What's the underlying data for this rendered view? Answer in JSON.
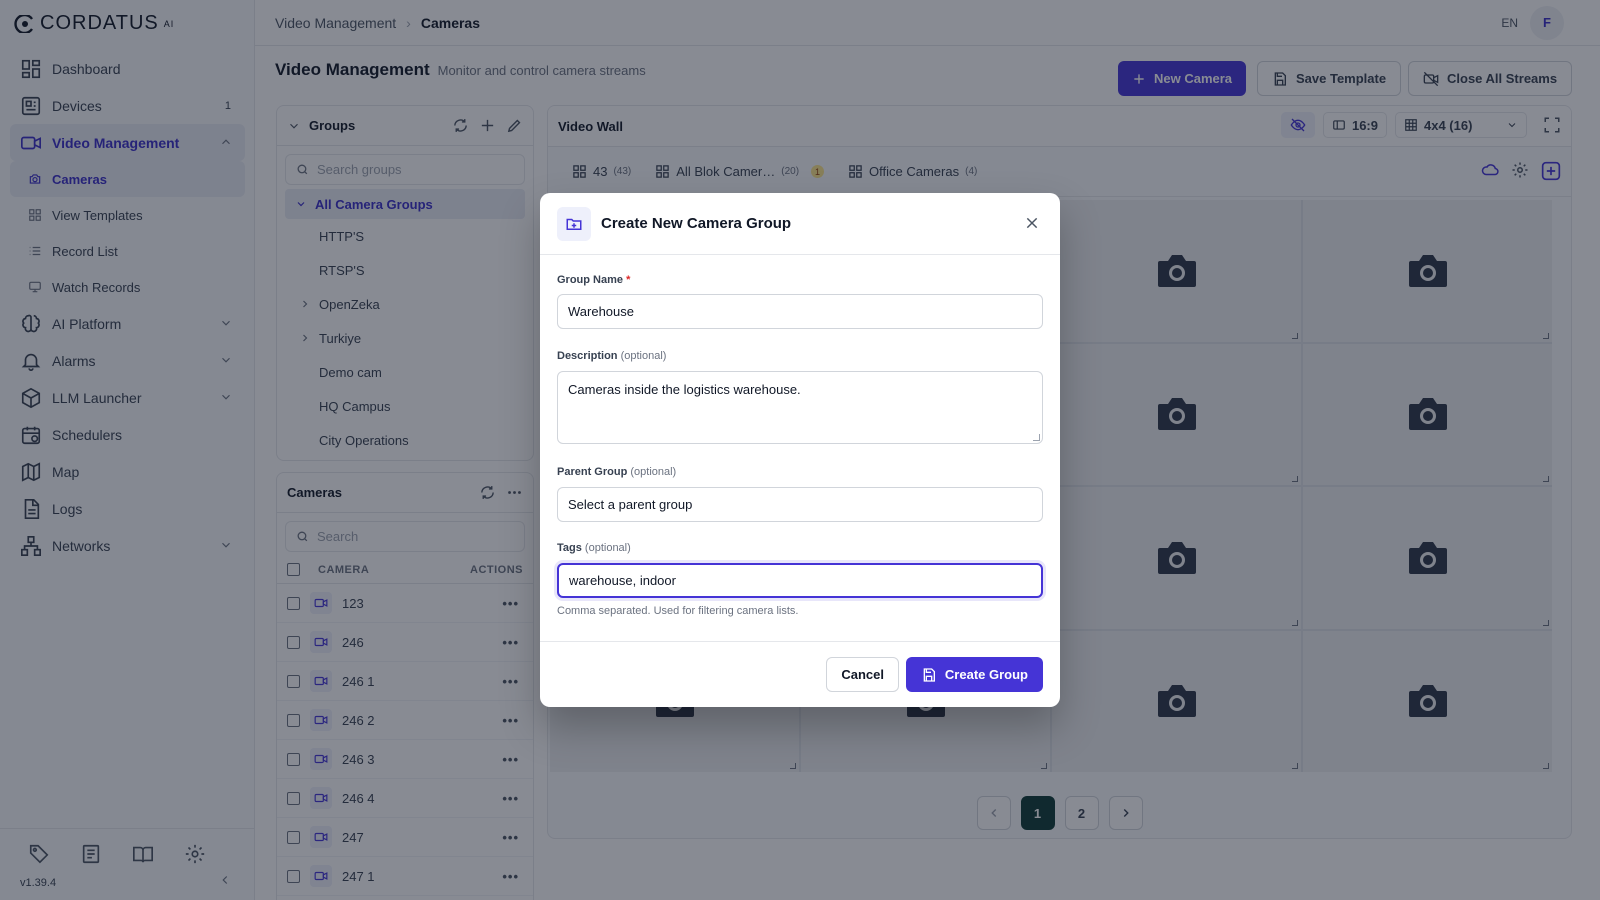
{
  "app": {
    "brand": "CORDATUS",
    "brand_sup": "AI",
    "version": "v1.39.4"
  },
  "sidebar": {
    "items": [
      {
        "label": "Dashboard",
        "icon": "dashboard-icon"
      },
      {
        "label": "Devices",
        "icon": "devices-icon",
        "badge": "1"
      },
      {
        "label": "Video Management",
        "icon": "video-icon"
      },
      {
        "label": "AI Platform",
        "icon": "brain-icon"
      },
      {
        "label": "Alarms",
        "icon": "bell-icon"
      },
      {
        "label": "LLM Launcher",
        "icon": "cube-icon"
      },
      {
        "label": "Schedulers",
        "icon": "calendar-icon"
      },
      {
        "label": "Map",
        "icon": "map-icon"
      },
      {
        "label": "Logs",
        "icon": "file-icon"
      },
      {
        "label": "Networks",
        "icon": "network-icon"
      }
    ],
    "sub_items": [
      {
        "label": "Cameras",
        "icon": "camera-icon"
      },
      {
        "label": "View Templates",
        "icon": "grid-icon"
      },
      {
        "label": "Record List",
        "icon": "list-icon"
      },
      {
        "label": "Watch Records",
        "icon": "monitor-icon"
      }
    ]
  },
  "topbar": {
    "crumb1": "Video Management",
    "crumb2": "Cameras",
    "lang": "EN",
    "avatar": "F"
  },
  "page": {
    "title": "Video Management",
    "subtitle": "Monitor and control camera streams",
    "new_camera": "New Camera",
    "save_template": "Save Template",
    "close_all": "Close All Streams"
  },
  "groups": {
    "title": "Groups",
    "search_placeholder": "Search groups",
    "all": "All Camera Groups",
    "items": [
      "HTTP'S",
      "RTSP'S",
      "OpenZeka",
      "Turkiye",
      "Demo cam",
      "HQ Campus",
      "City Operations"
    ]
  },
  "cameras": {
    "title": "Cameras",
    "search_placeholder": "Search",
    "col_camera": "CAMERA",
    "col_actions": "ACTIONS",
    "rows": [
      "123",
      "246",
      "246 1",
      "246 2",
      "246 3",
      "246 4",
      "247",
      "247 1"
    ]
  },
  "videowall": {
    "title": "Video Wall",
    "ratio": "16:9",
    "layout": "4x4 (16)",
    "tabs": [
      {
        "label": "43",
        "count": "(43)"
      },
      {
        "label": "All Blok Camer…",
        "count": "(20)",
        "badge": "1"
      },
      {
        "label": "Office Cameras",
        "count": "(4)"
      }
    ],
    "pages": [
      "1",
      "2"
    ]
  },
  "modal": {
    "title": "Create New Camera Group",
    "group_name_label": "Group Name",
    "required_mark": "*",
    "group_name_value": "Warehouse",
    "description_label": "Description",
    "optional": "(optional)",
    "description_value": "Cameras inside the logistics warehouse.",
    "parent_label": "Parent Group",
    "parent_placeholder": "Select a parent group",
    "tags_label": "Tags",
    "tags_value": "warehouse, indoor",
    "tags_hint": "Comma separated. Used for filtering camera lists.",
    "cancel": "Cancel",
    "create": "Create Group"
  },
  "colors": {
    "accent": "#4534d6",
    "active_bg": "#e9ecf5",
    "pager_current": "#0f3b36"
  }
}
